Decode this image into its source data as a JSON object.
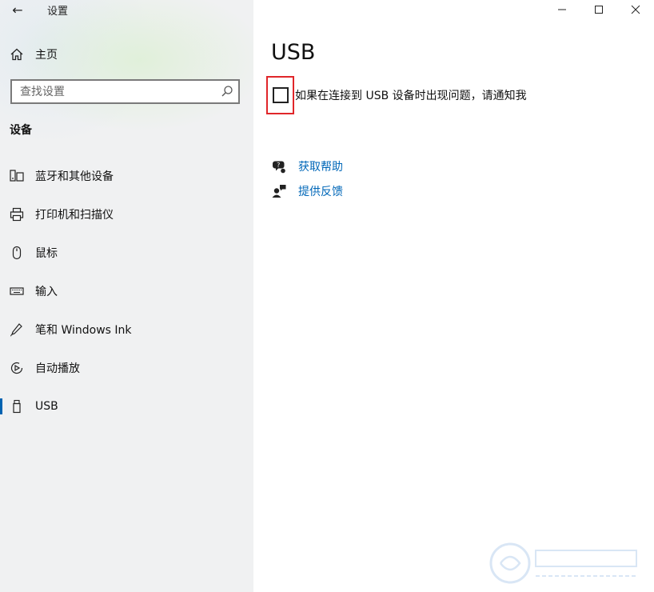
{
  "window": {
    "title": "设置",
    "back_glyph": "←",
    "controls": [
      "minimize-icon",
      "maximize-icon",
      "close-icon"
    ]
  },
  "sidebar": {
    "home_label": "主页",
    "search_placeholder": "查找设置",
    "section_header": "设备",
    "items": [
      {
        "label": "蓝牙和其他设备",
        "icon": "bluetooth-devices-icon",
        "active": false
      },
      {
        "label": "打印机和扫描仪",
        "icon": "printer-icon",
        "active": false
      },
      {
        "label": "鼠标",
        "icon": "mouse-icon",
        "active": false
      },
      {
        "label": "输入",
        "icon": "keyboard-icon",
        "active": false
      },
      {
        "label": "笔和 Windows Ink",
        "icon": "pen-icon",
        "active": false
      },
      {
        "label": "自动播放",
        "icon": "autoplay-icon",
        "active": false
      },
      {
        "label": "USB",
        "icon": "usb-icon",
        "active": true
      }
    ]
  },
  "main": {
    "title": "USB",
    "notify_checkbox": {
      "label": "如果在连接到 USB 设备时出现问题，请通知我",
      "checked": false
    },
    "links": [
      {
        "label": "获取帮助",
        "icon": "help-chat-icon"
      },
      {
        "label": "提供反馈",
        "icon": "feedback-icon"
      }
    ]
  },
  "colors": {
    "accent": "#0063b1",
    "link": "#0067b8",
    "highlight_border": "#e0262a",
    "sidebar_bg": "#f0f1f2"
  }
}
